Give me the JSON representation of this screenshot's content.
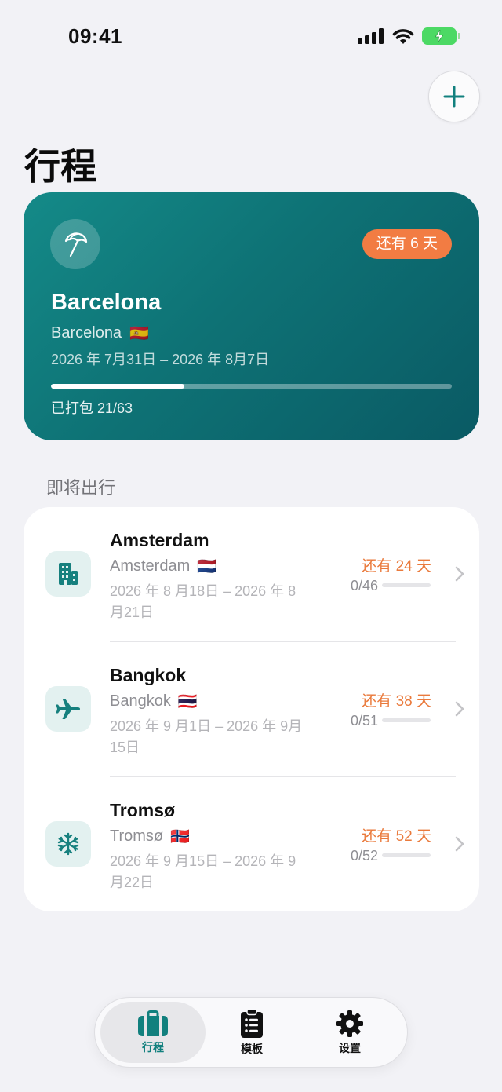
{
  "status_bar": {
    "time": "09:41"
  },
  "header": {
    "title": "行程"
  },
  "colors": {
    "accent": "#12807e",
    "badge_orange": "#f27c43",
    "countdown_orange": "#ea7a3c"
  },
  "hero": {
    "icon": "beach-umbrella-icon",
    "badge": "还有 6 天",
    "title": "Barcelona",
    "destination": "Barcelona",
    "flag": "🇪🇸",
    "dates": "2026 年 7月31日 – 2026 年 8月7日",
    "packed_label": "已打包 21/63",
    "packed_fraction": 0.333
  },
  "upcoming": {
    "section_title": "即将出行",
    "trips": [
      {
        "icon": "building-icon",
        "name": "Amsterdam",
        "destination": "Amsterdam",
        "flag": "🇳🇱",
        "dates": "2026 年 8 月18日 – 2026 年 8月21日",
        "countdown": "还有 24 天",
        "packed": "0/46",
        "packed_fraction": 0
      },
      {
        "icon": "airplane-icon",
        "name": "Bangkok",
        "destination": "Bangkok",
        "flag": "🇹🇭",
        "dates": "2026 年 9 月1日 – 2026 年 9月15日",
        "countdown": "还有 38 天",
        "packed": "0/51",
        "packed_fraction": 0
      },
      {
        "icon": "snowflake-icon",
        "name": "Tromsø",
        "destination": "Tromsø",
        "flag": "🇳🇴",
        "dates": "2026 年 9 月15日 – 2026 年 9月22日",
        "countdown": "还有 52 天",
        "packed": "0/52",
        "packed_fraction": 0
      }
    ]
  },
  "tab_bar": {
    "tabs": [
      {
        "label": "行程",
        "icon": "suitcase-icon",
        "active": true
      },
      {
        "label": "模板",
        "icon": "checklist-icon",
        "active": false
      },
      {
        "label": "设置",
        "icon": "gear-icon",
        "active": false
      }
    ]
  }
}
